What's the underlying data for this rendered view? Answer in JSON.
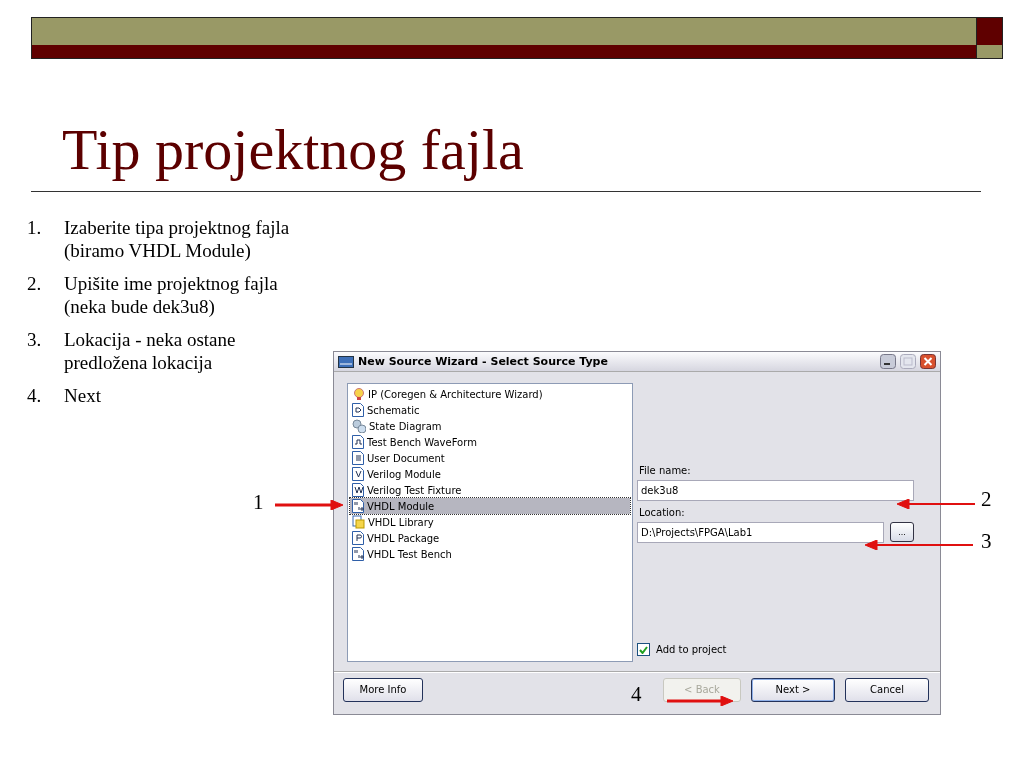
{
  "slide": {
    "title": "Tip projektnog fajla",
    "steps": [
      {
        "number": "1.",
        "lines": [
          "Izaberite tipa projektnog fajla",
          "(biramo VHDL Module)"
        ]
      },
      {
        "number": "2.",
        "lines": [
          "Upišite ime projektnog fajla",
          "(neka bude dek3u8)"
        ]
      },
      {
        "number": "3.",
        "lines": [
          "Lokacija - neka ostane",
          "predložena lokacija"
        ]
      },
      {
        "number": "4.",
        "lines": [
          "Next"
        ]
      }
    ]
  },
  "dialog": {
    "title": "New Source Wizard - Select Source Type",
    "source_types": [
      {
        "label": "IP (Coregen & Architecture Wizard)",
        "kind": "ip",
        "selected": false
      },
      {
        "label": "Schematic",
        "kind": "schematic",
        "selected": false
      },
      {
        "label": "State Diagram",
        "kind": "state",
        "selected": false
      },
      {
        "label": "Test Bench WaveForm",
        "kind": "waveform",
        "selected": false
      },
      {
        "label": "User Document",
        "kind": "document",
        "selected": false
      },
      {
        "label": "Verilog Module",
        "kind": "verilog",
        "selected": false
      },
      {
        "label": "Verilog Test Fixture",
        "kind": "fixture",
        "selected": false
      },
      {
        "label": "VHDL Module",
        "kind": "vhdl",
        "selected": true
      },
      {
        "label": "VHDL Library",
        "kind": "library",
        "selected": false
      },
      {
        "label": "VHDL Package",
        "kind": "package",
        "selected": false
      },
      {
        "label": "VHDL Test Bench",
        "kind": "testbench",
        "selected": false
      }
    ],
    "file_name": {
      "label": "File name:",
      "value": "dek3u8"
    },
    "location": {
      "label": "Location:",
      "value": "D:\\Projects\\FPGA\\Lab1",
      "browse": "..."
    },
    "add_to_project": {
      "label": "Add to project",
      "checked": true
    },
    "more_info": "More Info",
    "buttons": [
      {
        "label": "< Back",
        "disabled": true
      },
      {
        "label": "Next >",
        "disabled": false,
        "default": true
      },
      {
        "label": "Cancel",
        "disabled": false,
        "default": false
      }
    ]
  },
  "annotations": [
    {
      "label": "1"
    },
    {
      "label": "2"
    },
    {
      "label": "3"
    },
    {
      "label": "4"
    }
  ]
}
